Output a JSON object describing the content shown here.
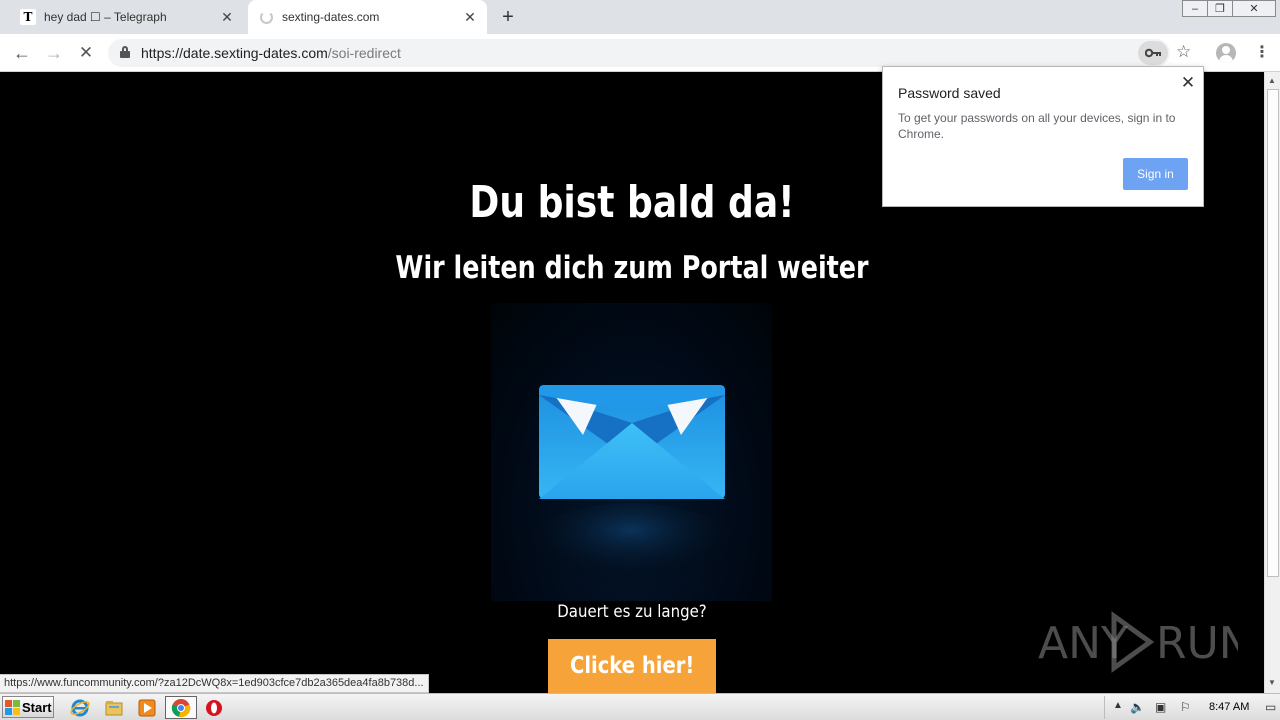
{
  "browser": {
    "tabs": [
      {
        "title": "hey dad ☐ – Telegraph",
        "favicon": "T"
      },
      {
        "title": "sexting-dates.com",
        "favicon": "loading-spinner"
      }
    ],
    "new_tab_label": "+",
    "window_controls": [
      "–",
      "❐",
      "✕"
    ],
    "url_host": "https://date.sexting-dates.com",
    "url_path": "/soi-redirect",
    "status_url": "https://www.funcommunity.com/?za12DcWQ8x=1ed903cfce7db2a365dea4fa8b738d...",
    "colors": {
      "tabstrip": "#dee1e6",
      "omnibox": "#f1f3f4"
    }
  },
  "popup": {
    "title": "Password saved",
    "text": "To get your passwords on all your devices, sign in to Chrome.",
    "signin_label": "Sign in",
    "close_label": "✕",
    "colors": {
      "signin": "#6da3f2"
    }
  },
  "page": {
    "headline": "Du bist bald da!",
    "subheadline": "Wir leiten dich zum Portal weiter",
    "question": "Dauert es zu lange?",
    "cta_label": "Clicke hier!",
    "colors": {
      "background": "#000000",
      "cta": "#f6a43a",
      "envelope": "#29a9ee"
    }
  },
  "watermark": {
    "left": "ANY",
    "right": "RUN"
  },
  "taskbar": {
    "start_label": "Start",
    "clock": "8:47 AM"
  }
}
